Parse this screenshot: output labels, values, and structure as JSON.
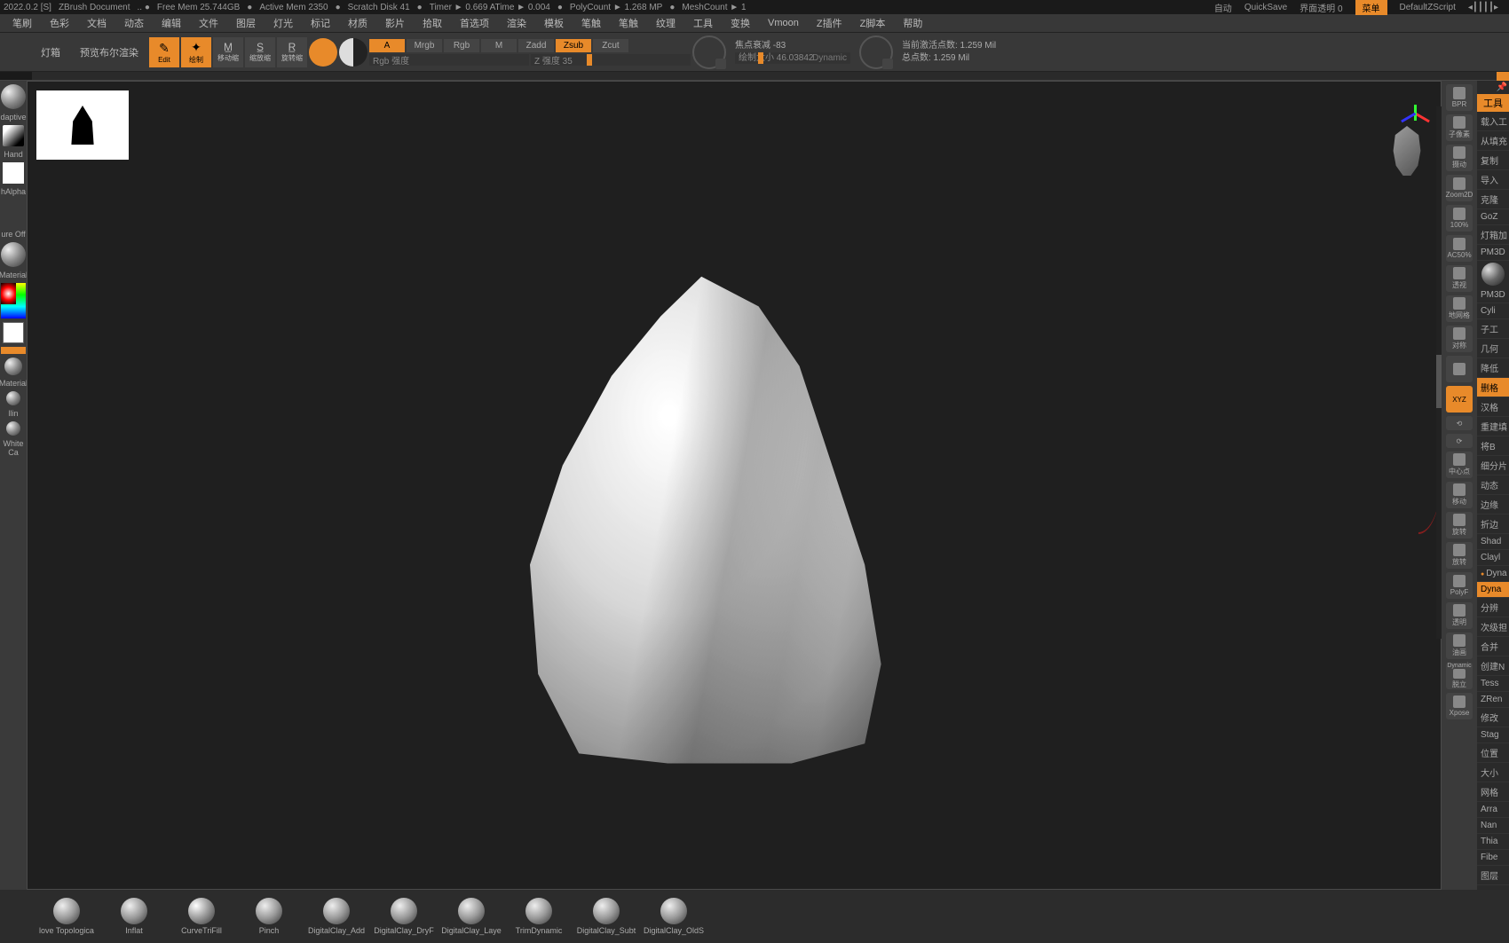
{
  "status": {
    "version": "2022.0.2 [S]",
    "doc": "ZBrush Document",
    "freeMem": "Free Mem 25.744GB",
    "activeMem": "Active Mem 2350",
    "scratch": "Scratch Disk 41",
    "timer": "Timer ► 0.669 ATime ► 0.004",
    "polyCount": "PolyCount ► 1.268 MP",
    "meshCount": "MeshCount ► 1",
    "auto": "自动",
    "quickSave": "QuickSave",
    "opacity": "界面透明 0",
    "menu": "菜单",
    "script": "DefaultZScript"
  },
  "menus": [
    "笔刷",
    "色彩",
    "文档",
    "动态",
    "编辑",
    "文件",
    "图层",
    "灯光",
    "标记",
    "材质",
    "影片",
    "拾取",
    "首选项",
    "渲染",
    "模板",
    "笔触",
    "笔触",
    "纹理",
    "工具",
    "变换",
    "Vmoon",
    "Z插件",
    "Z脚本",
    "帮助"
  ],
  "toolbar": {
    "lightbox": "灯箱",
    "preview": "预览布尔渲染",
    "edit": "Edit",
    "draw": "绘制",
    "move": "移动缩",
    "scale": "缩放缩",
    "rotate": "旋转缩",
    "a": "A",
    "mrgb": "Mrgb",
    "rgb": "Rgb",
    "m": "M",
    "zadd": "Zadd",
    "zsub": "Zsub",
    "zcut": "Zcut",
    "rgbInt": "Rgb 强度",
    "zInt": "Z 强度 35",
    "focalLabel": "焦点衰减 -83",
    "drawSizeLabel": "绘制大小 46.03842",
    "dynamic": "Dynamic",
    "activePts": "当前激活点数: 1.259 Mil",
    "totalPts": "总点数: 1.259 Mil"
  },
  "left": {
    "adaptive": "daptive",
    "hand": "Hand",
    "alpha": "hAlpha",
    "texOff": "ure Off",
    "material": "Material",
    "material2": "Material",
    "pinch": "llin",
    "whiteCa": "White Ca"
  },
  "rightTools": [
    "BPR",
    "子像素",
    "摄动",
    "Zoom2D",
    "100%",
    "AC50%",
    "透视",
    "地网格",
    "对称",
    "",
    "XYZ",
    "",
    "",
    "中心点",
    "移动",
    "旋转",
    "放转",
    "PolyF",
    "透明",
    "油画",
    "Dynamic",
    "脱立",
    "Xpose"
  ],
  "farRight": {
    "header": "工具",
    "items": [
      "载入工",
      "从填充",
      "复制",
      "导入",
      "克隆",
      "GoZ",
      "灯箱加",
      "PM3D",
      "",
      "PM3D",
      "Cyli",
      "子工",
      "几何",
      "降低",
      "删格",
      "汉格",
      "重建填",
      "将B",
      "细分片",
      "动态",
      "边缘",
      "折边",
      "Shad",
      "Clayl",
      "Dyna",
      "Dyna",
      "分辨",
      "次级担",
      "合并",
      "创建N",
      "Tess",
      "ZRen",
      "修改",
      "Stag",
      "位置",
      "大小",
      "网格",
      "Arra",
      "Nan",
      "Thia",
      "Fibe",
      "图层"
    ]
  },
  "brushes": [
    "love Topologica",
    "Inflat",
    "CurveTriFill",
    "Pinch",
    "DigitalClay_Add",
    "DigitalClay_DryF",
    "DigitalClay_Laye",
    "TrimDynamic",
    "DigitalClay_Subt",
    "DigitalClay_OldS"
  ]
}
